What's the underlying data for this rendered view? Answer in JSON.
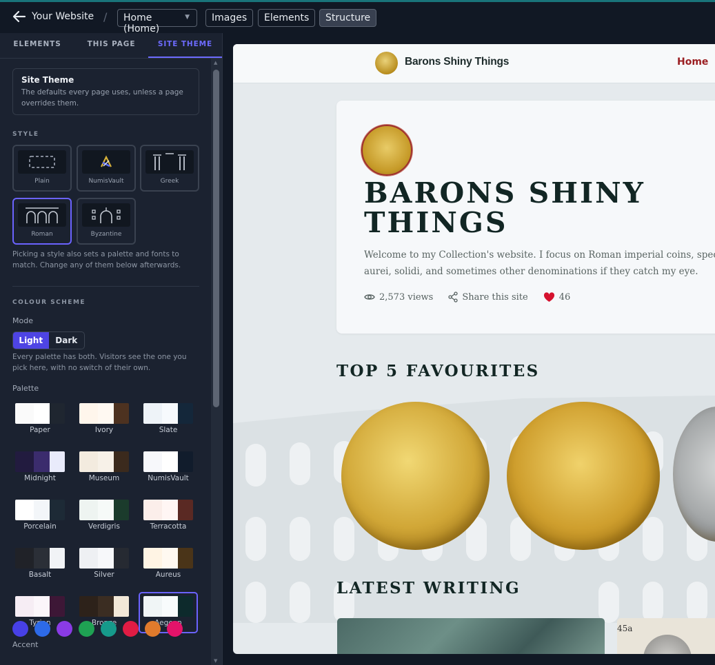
{
  "topbar": {
    "back_label": "Your Website",
    "separator": "/",
    "page_select": "Home (Home)",
    "buttons": [
      "Images",
      "Elements",
      "Structure"
    ],
    "active_button": "Structure"
  },
  "sidebar": {
    "tabs": [
      "ELEMENTS",
      "THIS PAGE",
      "SITE THEME"
    ],
    "active_tab": "SITE THEME",
    "info": {
      "title": "Site Theme",
      "description": "The defaults every page uses, unless a page overrides them."
    },
    "style_section": "STYLE",
    "styles": [
      "Plain",
      "NumisVault",
      "Greek",
      "Roman",
      "Byzantine"
    ],
    "selected_style": "Roman",
    "style_help": "Picking a style also sets a palette and fonts to match. Change any of them below afterwards.",
    "colour_section": "COLOUR SCHEME",
    "mode_label": "Mode",
    "modes": [
      "Light",
      "Dark"
    ],
    "selected_mode": "Light",
    "mode_help": "Every palette has both. Visitors see the one you pick here, with no switch of their own.",
    "palette_label": "Palette",
    "palettes": [
      {
        "name": "Paper",
        "colors": [
          "#fafafa",
          "#ffffff",
          "#1f2630"
        ]
      },
      {
        "name": "Ivory",
        "colors": [
          "#fff6ec",
          "#fff9f2",
          "#4d3220"
        ]
      },
      {
        "name": "Slate",
        "colors": [
          "#eef3f8",
          "#f7fafd",
          "#14273a"
        ]
      },
      {
        "name": "Midnight",
        "colors": [
          "#221b3f",
          "#3b2c6d",
          "#e9ebfb"
        ]
      },
      {
        "name": "Museum",
        "colors": [
          "#f3ebdf",
          "#f7f1e8",
          "#3b2a1d"
        ]
      },
      {
        "name": "NumisVault",
        "colors": [
          "#f7f8fb",
          "#ffffff",
          "#111c2c"
        ]
      },
      {
        "name": "Porcelain",
        "colors": [
          "#ffffff",
          "#f3f6f9",
          "#1d2a36"
        ]
      },
      {
        "name": "Verdigris",
        "colors": [
          "#eef4f1",
          "#f6faf8",
          "#1b3b2c"
        ]
      },
      {
        "name": "Terracotta",
        "colors": [
          "#fbeeea",
          "#fff6f4",
          "#5a2923"
        ]
      },
      {
        "name": "Basalt",
        "colors": [
          "#202228",
          "#2b2f37",
          "#f1f3f6"
        ]
      },
      {
        "name": "Silver",
        "colors": [
          "#eef0f3",
          "#f7f8fa",
          "#262a32"
        ]
      },
      {
        "name": "Aureus",
        "colors": [
          "#fff4e4",
          "#fff9f1",
          "#4a3418"
        ]
      },
      {
        "name": "Tyrian",
        "colors": [
          "#f6edf4",
          "#fbf6fa",
          "#3d1736"
        ]
      },
      {
        "name": "Bronze",
        "colors": [
          "#2d221a",
          "#3b2d22",
          "#f2e8d8"
        ]
      },
      {
        "name": "Aegean",
        "colors": [
          "#f0f5f6",
          "#f8fbfc",
          "#0d2a2c"
        ]
      }
    ],
    "selected_palette": "Aegean",
    "accent_label": "Accent",
    "accents": [
      "#4740e6",
      "#2d6ae8",
      "#8a3be5",
      "#1fa253",
      "#169a8b",
      "#e01c44",
      "#e07b2c",
      "#e3136a"
    ]
  },
  "preview": {
    "nav_title": "Barons Shiny Things",
    "nav_link": "Home",
    "hero_title": "BARONS SHINY THINGS",
    "hero_description": "Welcome to my Collection's website. I focus on Roman imperial coins, specifically aurei, solidi, and sometimes other denominations if they catch my eye.",
    "views": "2,573 views",
    "share": "Share this site",
    "likes": "46",
    "favourites_title": "TOP 5 FAVOURITES",
    "writing_title": "LATEST WRITING",
    "article_fragment": "45a"
  }
}
